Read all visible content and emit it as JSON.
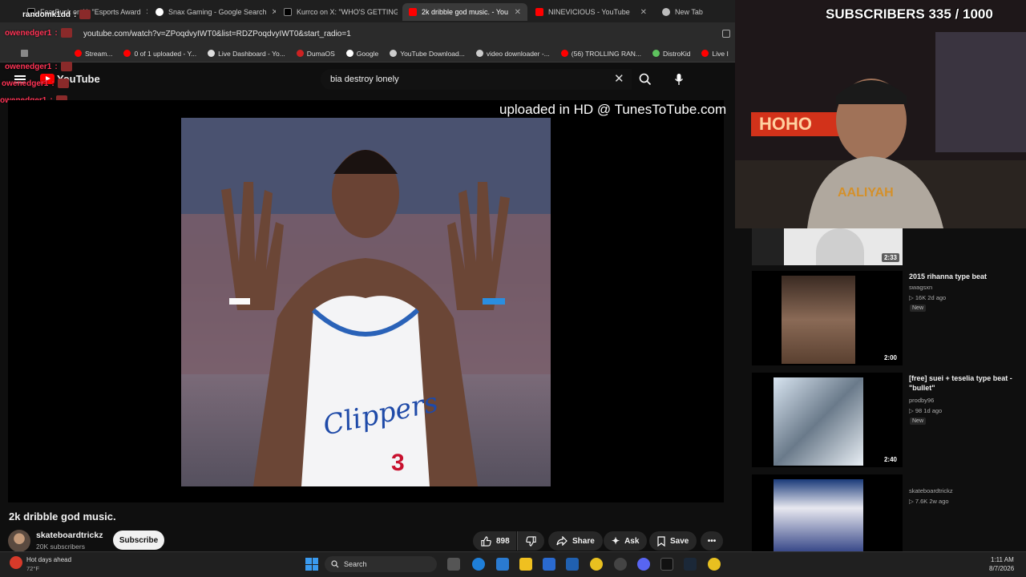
{
  "browser": {
    "tabs": [
      {
        "label": "FearBuck on X: \"Esports Award",
        "active": false
      },
      {
        "label": "Snax Gaming - Google Search",
        "active": false
      },
      {
        "label": "Kurrco on X: \"WHO'S GETTING",
        "active": false
      },
      {
        "label": "2k dribble god music. - You",
        "active": true
      },
      {
        "label": "NINEVICIOUS - YouTube",
        "active": false
      },
      {
        "label": "New Tab",
        "active": false
      }
    ],
    "url": "youtube.com/watch?v=ZPoqdvyIWT0&list=RDZPoqdvyIWT0&start_radio=1",
    "bookmarks": [
      "Stream...",
      "0 of 1 uploaded - Y...",
      "Live Dashboard - Yo...",
      "DumaOS",
      "Google",
      "YouTube Download...",
      "video downloader -...",
      "(56) TROLLING RAN...",
      "DistroKid",
      "Live I"
    ]
  },
  "youtube": {
    "logo_text": "YouTube",
    "search_value": "bia destroy lonely"
  },
  "chat_overlay": [
    {
      "user": "randomk1dd",
      "white": true
    },
    {
      "user": "owenedger1",
      "white": false
    },
    {
      "user": "owenedger1",
      "white": false
    },
    {
      "user": "owenedger1",
      "white": false
    },
    {
      "user": "owenedger1",
      "white": false
    }
  ],
  "player": {
    "watermark": "uploaded in HD @ TunesToTube.com",
    "jersey_text": "Clippers",
    "jersey_number": "3"
  },
  "video": {
    "title": "2k dribble god music.",
    "channel": "skateboardtrickz",
    "subscribers": "20K subscribers",
    "subscribe_label": "Subscribe",
    "likes": "898",
    "share_label": "Share",
    "ask_label": "Ask",
    "save_label": "Save"
  },
  "stream_overlay": {
    "subscriber_goal": "SUBSCRIBERS 335 / 1000"
  },
  "recommendations": [
    {
      "title": "",
      "channel": "",
      "meta": "",
      "duration": "2:33",
      "is_new": false
    },
    {
      "title": "2015 rihanna type beat",
      "channel": "swagsxn",
      "meta": "16K  2d ago",
      "duration": "2:00",
      "is_new": true
    },
    {
      "title": "[free] suei + teselia type beat - \"bullet\"",
      "channel": "prodby96",
      "meta": "98  1d ago",
      "duration": "2:40",
      "is_new": true
    },
    {
      "title": "",
      "channel": "skateboardtrickz",
      "meta": "7.6K  2w ago",
      "duration": "",
      "is_new": false
    }
  ],
  "new_badge": "New",
  "taskbar": {
    "weather_text": "Hot days ahead",
    "weather_temp": "72°F",
    "search_label": "Search",
    "time": "1:11 AM",
    "date": "8/7/2026"
  },
  "colors": {
    "accent_red": "#ff0000",
    "background": "#0f0f0f"
  }
}
